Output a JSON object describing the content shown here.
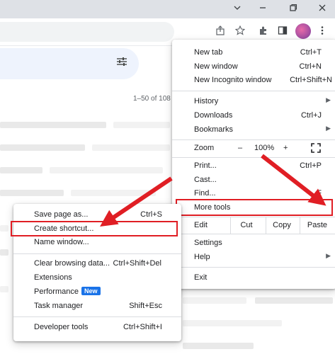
{
  "window": {
    "minimize_icon": "chevron-down-icon",
    "restore_icon": "restore-icon",
    "close_icon": "close-icon"
  },
  "page": {
    "range_text": "1–50 of 108"
  },
  "menu": {
    "new_tab": {
      "label": "New tab",
      "shortcut": "Ctrl+T"
    },
    "new_window": {
      "label": "New window",
      "shortcut": "Ctrl+N"
    },
    "new_incognito": {
      "label": "New Incognito window",
      "shortcut": "Ctrl+Shift+N"
    },
    "history": {
      "label": "History"
    },
    "downloads": {
      "label": "Downloads",
      "shortcut": "Ctrl+J"
    },
    "bookmarks": {
      "label": "Bookmarks"
    },
    "zoom": {
      "label": "Zoom",
      "minus": "–",
      "value": "100%",
      "plus": "+"
    },
    "print": {
      "label": "Print...",
      "shortcut": "Ctrl+P"
    },
    "cast": {
      "label": "Cast..."
    },
    "find": {
      "label": "Find...",
      "shortcut": "F"
    },
    "more_tools": {
      "label": "More tools"
    },
    "edit": {
      "label": "Edit",
      "cut": "Cut",
      "copy": "Copy",
      "paste": "Paste"
    },
    "settings": {
      "label": "Settings"
    },
    "help": {
      "label": "Help"
    },
    "exit": {
      "label": "Exit"
    }
  },
  "submenu": {
    "save_page": {
      "label": "Save page as...",
      "shortcut": "Ctrl+S"
    },
    "create_shortcut": {
      "label": "Create shortcut..."
    },
    "name_window": {
      "label": "Name window..."
    },
    "clear_browsing": {
      "label": "Clear browsing data...",
      "shortcut": "Ctrl+Shift+Del"
    },
    "extensions": {
      "label": "Extensions"
    },
    "performance": {
      "label": "Performance",
      "badge": "New"
    },
    "task_manager": {
      "label": "Task manager",
      "shortcut": "Shift+Esc"
    },
    "developer_tools": {
      "label": "Developer tools",
      "shortcut": "Ctrl+Shift+I"
    }
  },
  "colors": {
    "annotation_red": "#e01e24",
    "badge_blue": "#1a73e8"
  }
}
